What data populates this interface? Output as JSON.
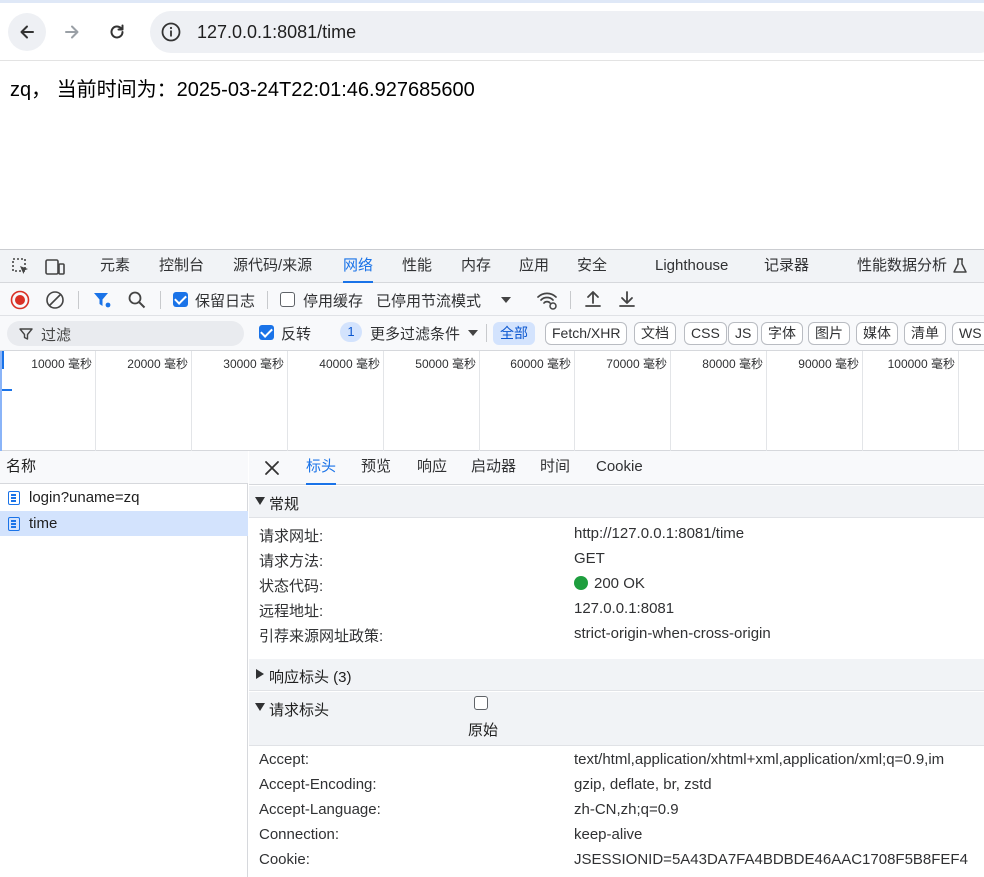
{
  "browser": {
    "url": "127.0.0.1:8081/time"
  },
  "page": {
    "text": "zq， 当前时间为：2025-03-24T22:01:46.927685600"
  },
  "devtools": {
    "tabs": [
      "元素",
      "控制台",
      "源代码/来源",
      "网络",
      "性能",
      "内存",
      "应用",
      "安全",
      "Lighthouse",
      "记录器",
      "性能数据分析"
    ],
    "active_tab": "网络",
    "toolbar": {
      "preserve_log": "保留日志",
      "disable_cache": "停用缓存",
      "throttling": "已停用节流模式"
    },
    "filter": {
      "placeholder": "过滤",
      "invert": "反转",
      "more_filters_count": "1",
      "more_filters": "更多过滤条件",
      "types": [
        "全部",
        "Fetch/XHR",
        "文档",
        "CSS",
        "JS",
        "字体",
        "图片",
        "媒体",
        "清单",
        "WS"
      ]
    },
    "timeline_ticks": [
      "10000 毫秒",
      "20000 毫秒",
      "30000 毫秒",
      "40000 毫秒",
      "50000 毫秒",
      "60000 毫秒",
      "70000 毫秒",
      "80000 毫秒",
      "90000 毫秒",
      "100000 毫秒"
    ],
    "requests": {
      "header": "名称",
      "rows": [
        {
          "name": "login?uname=zq",
          "selected": false
        },
        {
          "name": "time",
          "selected": true
        }
      ]
    },
    "detail": {
      "tabs": [
        "标头",
        "预览",
        "响应",
        "启动器",
        "时间",
        "Cookie"
      ],
      "active_tab": "标头",
      "general": {
        "title": "常规",
        "rows": [
          {
            "key": "请求网址:",
            "value": "http://127.0.0.1:8081/time"
          },
          {
            "key": "请求方法:",
            "value": "GET"
          },
          {
            "key": "状态代码:",
            "value": "200 OK"
          },
          {
            "key": "远程地址:",
            "value": "127.0.0.1:8081"
          },
          {
            "key": "引荐来源网址政策:",
            "value": "strict-origin-when-cross-origin"
          }
        ]
      },
      "response_headers": {
        "title": "响应标头 (3)"
      },
      "request_headers": {
        "title": "请求标头",
        "raw_label": "原始",
        "rows": [
          {
            "key": "Accept:",
            "value": "text/html,application/xhtml+xml,application/xml;q=0.9,im"
          },
          {
            "key": "Accept-Encoding:",
            "value": "gzip, deflate, br, zstd"
          },
          {
            "key": "Accept-Language:",
            "value": "zh-CN,zh;q=0.9"
          },
          {
            "key": "Connection:",
            "value": "keep-alive"
          },
          {
            "key": "Cookie:",
            "value": "JSESSIONID=5A43DA7FA4BDBDE46AAC1708F5B8FEF4"
          }
        ]
      }
    },
    "colors": {
      "accent": "#1a73e8",
      "status_ok": "#1e9e3e"
    }
  }
}
